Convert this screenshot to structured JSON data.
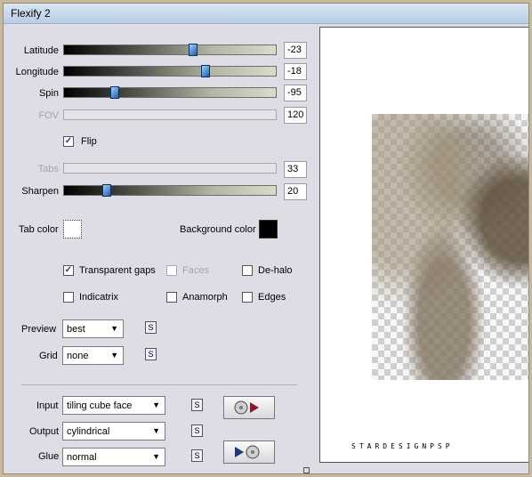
{
  "window": {
    "title": "Flexify 2"
  },
  "sliders": [
    {
      "name": "latitude",
      "label": "Latitude",
      "value": "-23",
      "fraction": 0.61,
      "enabled": true
    },
    {
      "name": "longitude",
      "label": "Longitude",
      "value": "-18",
      "fraction": 0.67,
      "enabled": true
    },
    {
      "name": "spin",
      "label": "Spin",
      "value": "-95",
      "fraction": 0.24,
      "enabled": true
    },
    {
      "name": "fov",
      "label": "FOV",
      "value": "120",
      "enabled": false
    },
    {
      "name": "tabs",
      "label": "Tabs",
      "value": "33",
      "enabled": false
    },
    {
      "name": "sharpen",
      "label": "Sharpen",
      "value": "20",
      "fraction": 0.2,
      "enabled": true
    }
  ],
  "flip": {
    "label": "Flip",
    "checked": true
  },
  "colors": {
    "tab_color_label": "Tab color",
    "tab_color": "#ffffff",
    "background_color_label": "Background color",
    "background_color": "#000000"
  },
  "options": {
    "transparent_gaps": {
      "label": "Transparent gaps",
      "checked": true
    },
    "faces": {
      "label": "Faces",
      "checked": false,
      "enabled": false
    },
    "de_halo": {
      "label": "De-halo",
      "checked": false
    },
    "indicatrix": {
      "label": "Indicatrix",
      "checked": false
    },
    "anamorph": {
      "label": "Anamorph",
      "checked": false
    },
    "edges": {
      "label": "Edges",
      "checked": false
    }
  },
  "preview": {
    "label": "Preview",
    "value": "best"
  },
  "grid": {
    "label": "Grid",
    "value": "none"
  },
  "input": {
    "label": "Input",
    "value": "tiling cube face"
  },
  "output": {
    "label": "Output",
    "value": "cylindrical"
  },
  "glue": {
    "label": "Glue",
    "value": "normal"
  },
  "s_button_label": "S",
  "watermark": "STARDESIGNPSP",
  "check_mark": "✓",
  "dropdown_arrow": "▼"
}
